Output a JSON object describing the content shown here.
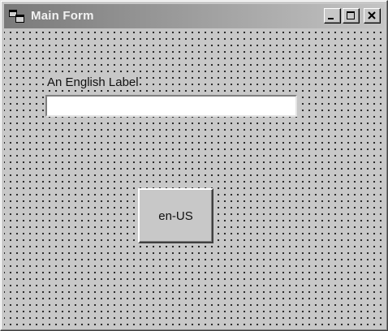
{
  "window": {
    "title": "Main Form",
    "icon": "app-window-icon",
    "controls": {
      "minimize": "minimize-icon",
      "maximize": "maximize-icon",
      "close": "close-icon"
    }
  },
  "form": {
    "label_text": "An English Label",
    "textbox_value": "",
    "button_label": "en-US"
  },
  "colors": {
    "face": "#c8c8c8",
    "titlebar_start": "#7a7a7a",
    "titlebar_end": "#c4c4c4"
  }
}
